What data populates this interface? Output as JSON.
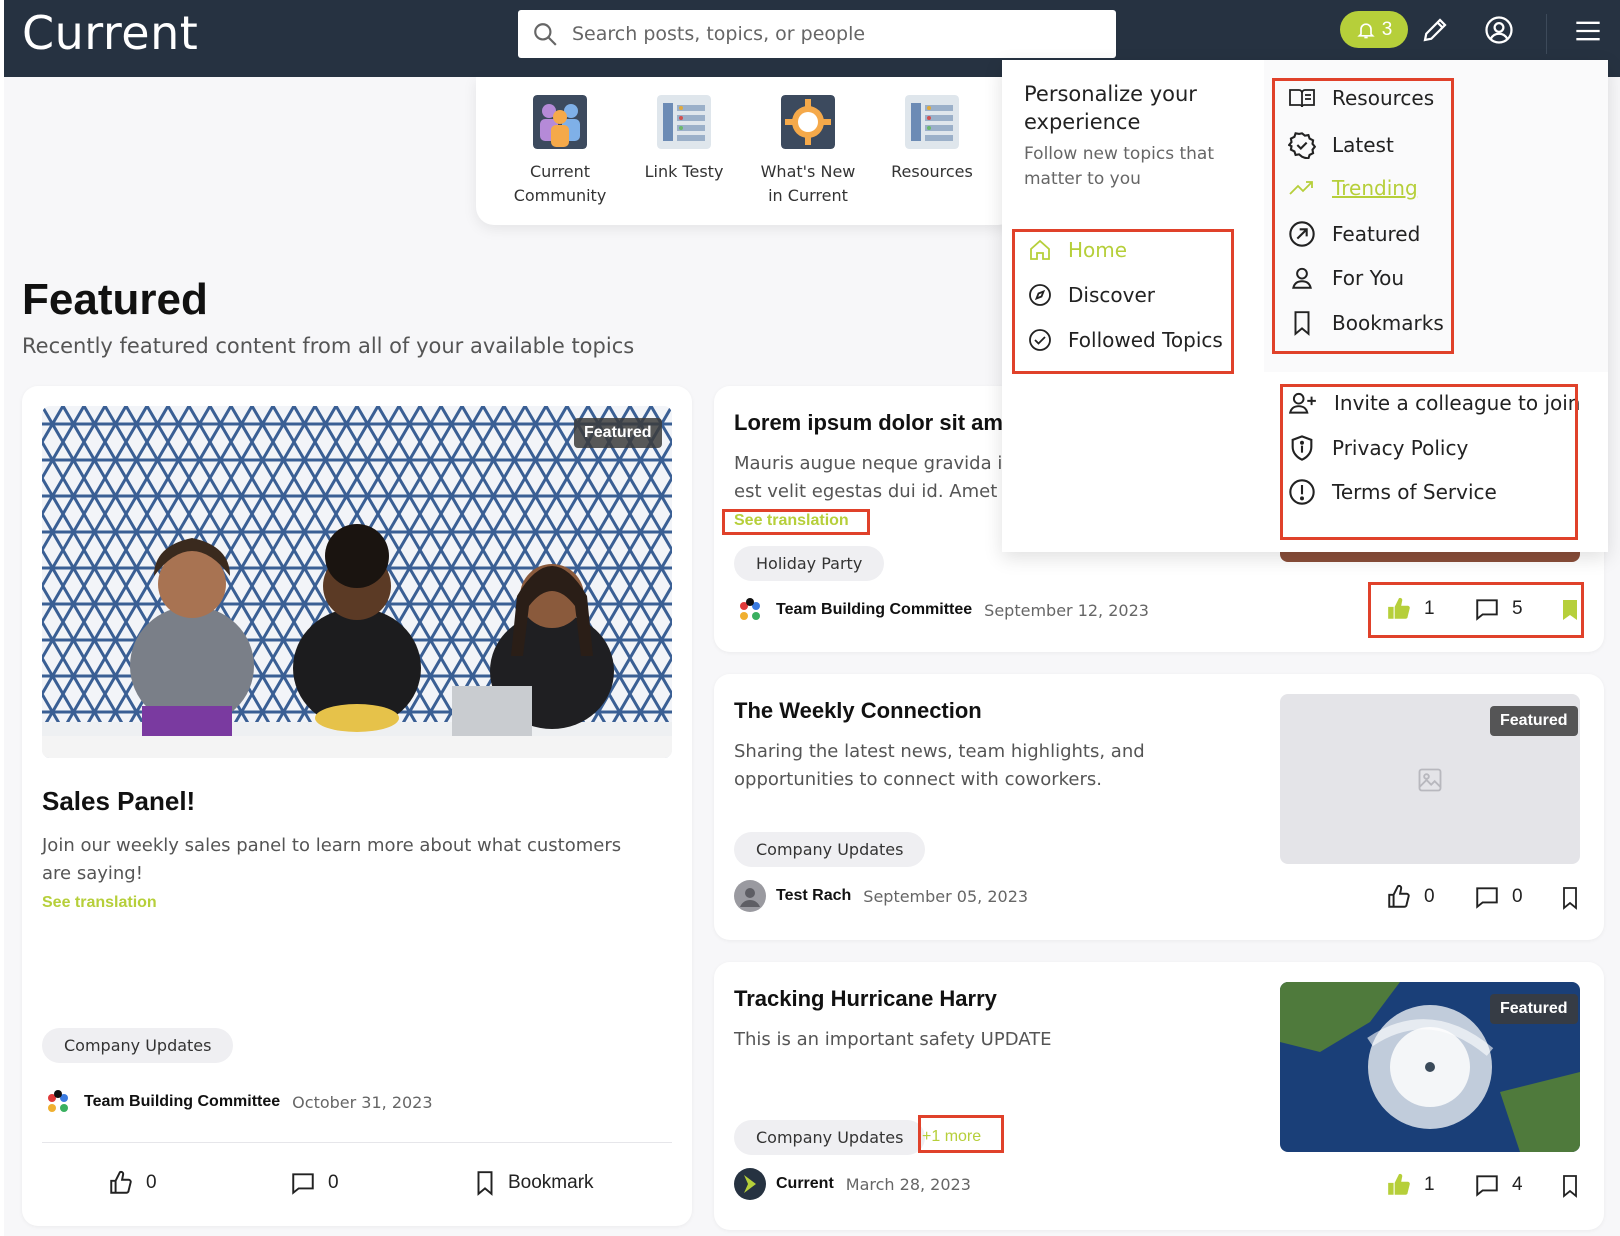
{
  "header": {
    "logo": "Current",
    "search_placeholder": "Search posts, topics, or people",
    "notification_count": "3",
    "colors": {
      "bar": "#263241",
      "accent": "#b6cf3a"
    }
  },
  "quick_links": [
    {
      "label_line1": "Current",
      "label_line2": "Community",
      "icon": "people-icon"
    },
    {
      "label_line1": "Link Testy",
      "label_line2": "",
      "icon": "list-icon"
    },
    {
      "label_line1": "What's New",
      "label_line2": "in Current",
      "icon": "gear-icon"
    },
    {
      "label_line1": "Resources",
      "label_line2": "",
      "icon": "list-icon"
    }
  ],
  "page": {
    "title": "Featured",
    "subtitle": "Recently featured content from all of your available topics"
  },
  "cards": {
    "main": {
      "badge": "Featured",
      "title": "Sales Panel!",
      "description": "Join our weekly sales panel to learn more about what customers are saying!",
      "see_translation": "See translation",
      "tag": "Company Updates",
      "author": "Team Building Committee",
      "date": "October 31, 2023",
      "likes": "0",
      "comments": "0",
      "bookmark_label": "Bookmark"
    },
    "lorem": {
      "title": "Lorem ipsum dolor sit ame",
      "desc_line1": "Mauris augue neque gravida ir",
      "desc_line2": "est velit egestas dui id. Amet c",
      "see_translation": "See translation",
      "tag": "Holiday Party",
      "author": "Team Building Committee",
      "date": "September 12, 2023",
      "likes": "1",
      "comments": "5"
    },
    "weekly": {
      "badge": "Featured",
      "title": "The Weekly Connection",
      "description": "Sharing the latest news, team highlights, and opportunities to connect with coworkers.",
      "tag": "Company Updates",
      "author": "Test Rach",
      "date": "September 05, 2023",
      "likes": "0",
      "comments": "0"
    },
    "hurricane": {
      "badge": "Featured",
      "title": "Tracking Hurricane Harry",
      "description": "This is an important safety UPDATE",
      "tag": "Company Updates",
      "more": "+1 more",
      "author": "Current",
      "date": "March 28, 2023",
      "likes": "1",
      "comments": "4"
    }
  },
  "menu": {
    "heading": "Personalize your experience",
    "subheading": "Follow new topics that matter to you",
    "nav": [
      {
        "label": "Home",
        "icon": "home-icon",
        "active": true
      },
      {
        "label": "Discover",
        "icon": "compass-icon"
      },
      {
        "label": "Followed Topics",
        "icon": "check-circle-icon"
      }
    ],
    "feeds": [
      {
        "label": "Resources",
        "icon": "book-icon"
      },
      {
        "label": "Latest",
        "icon": "badge-check-icon"
      },
      {
        "label": "Trending",
        "icon": "trending-icon",
        "active": true
      },
      {
        "label": "Featured",
        "icon": "arrow-up-right-icon"
      },
      {
        "label": "For You",
        "icon": "user-icon"
      },
      {
        "label": "Bookmarks",
        "icon": "bookmark-icon"
      }
    ],
    "footer": [
      {
        "label": "Invite a colleague to join",
        "icon": "user-plus-icon"
      },
      {
        "label": "Privacy Policy",
        "icon": "shield-icon"
      },
      {
        "label": "Terms of Service",
        "icon": "alert-circle-icon"
      }
    ]
  }
}
